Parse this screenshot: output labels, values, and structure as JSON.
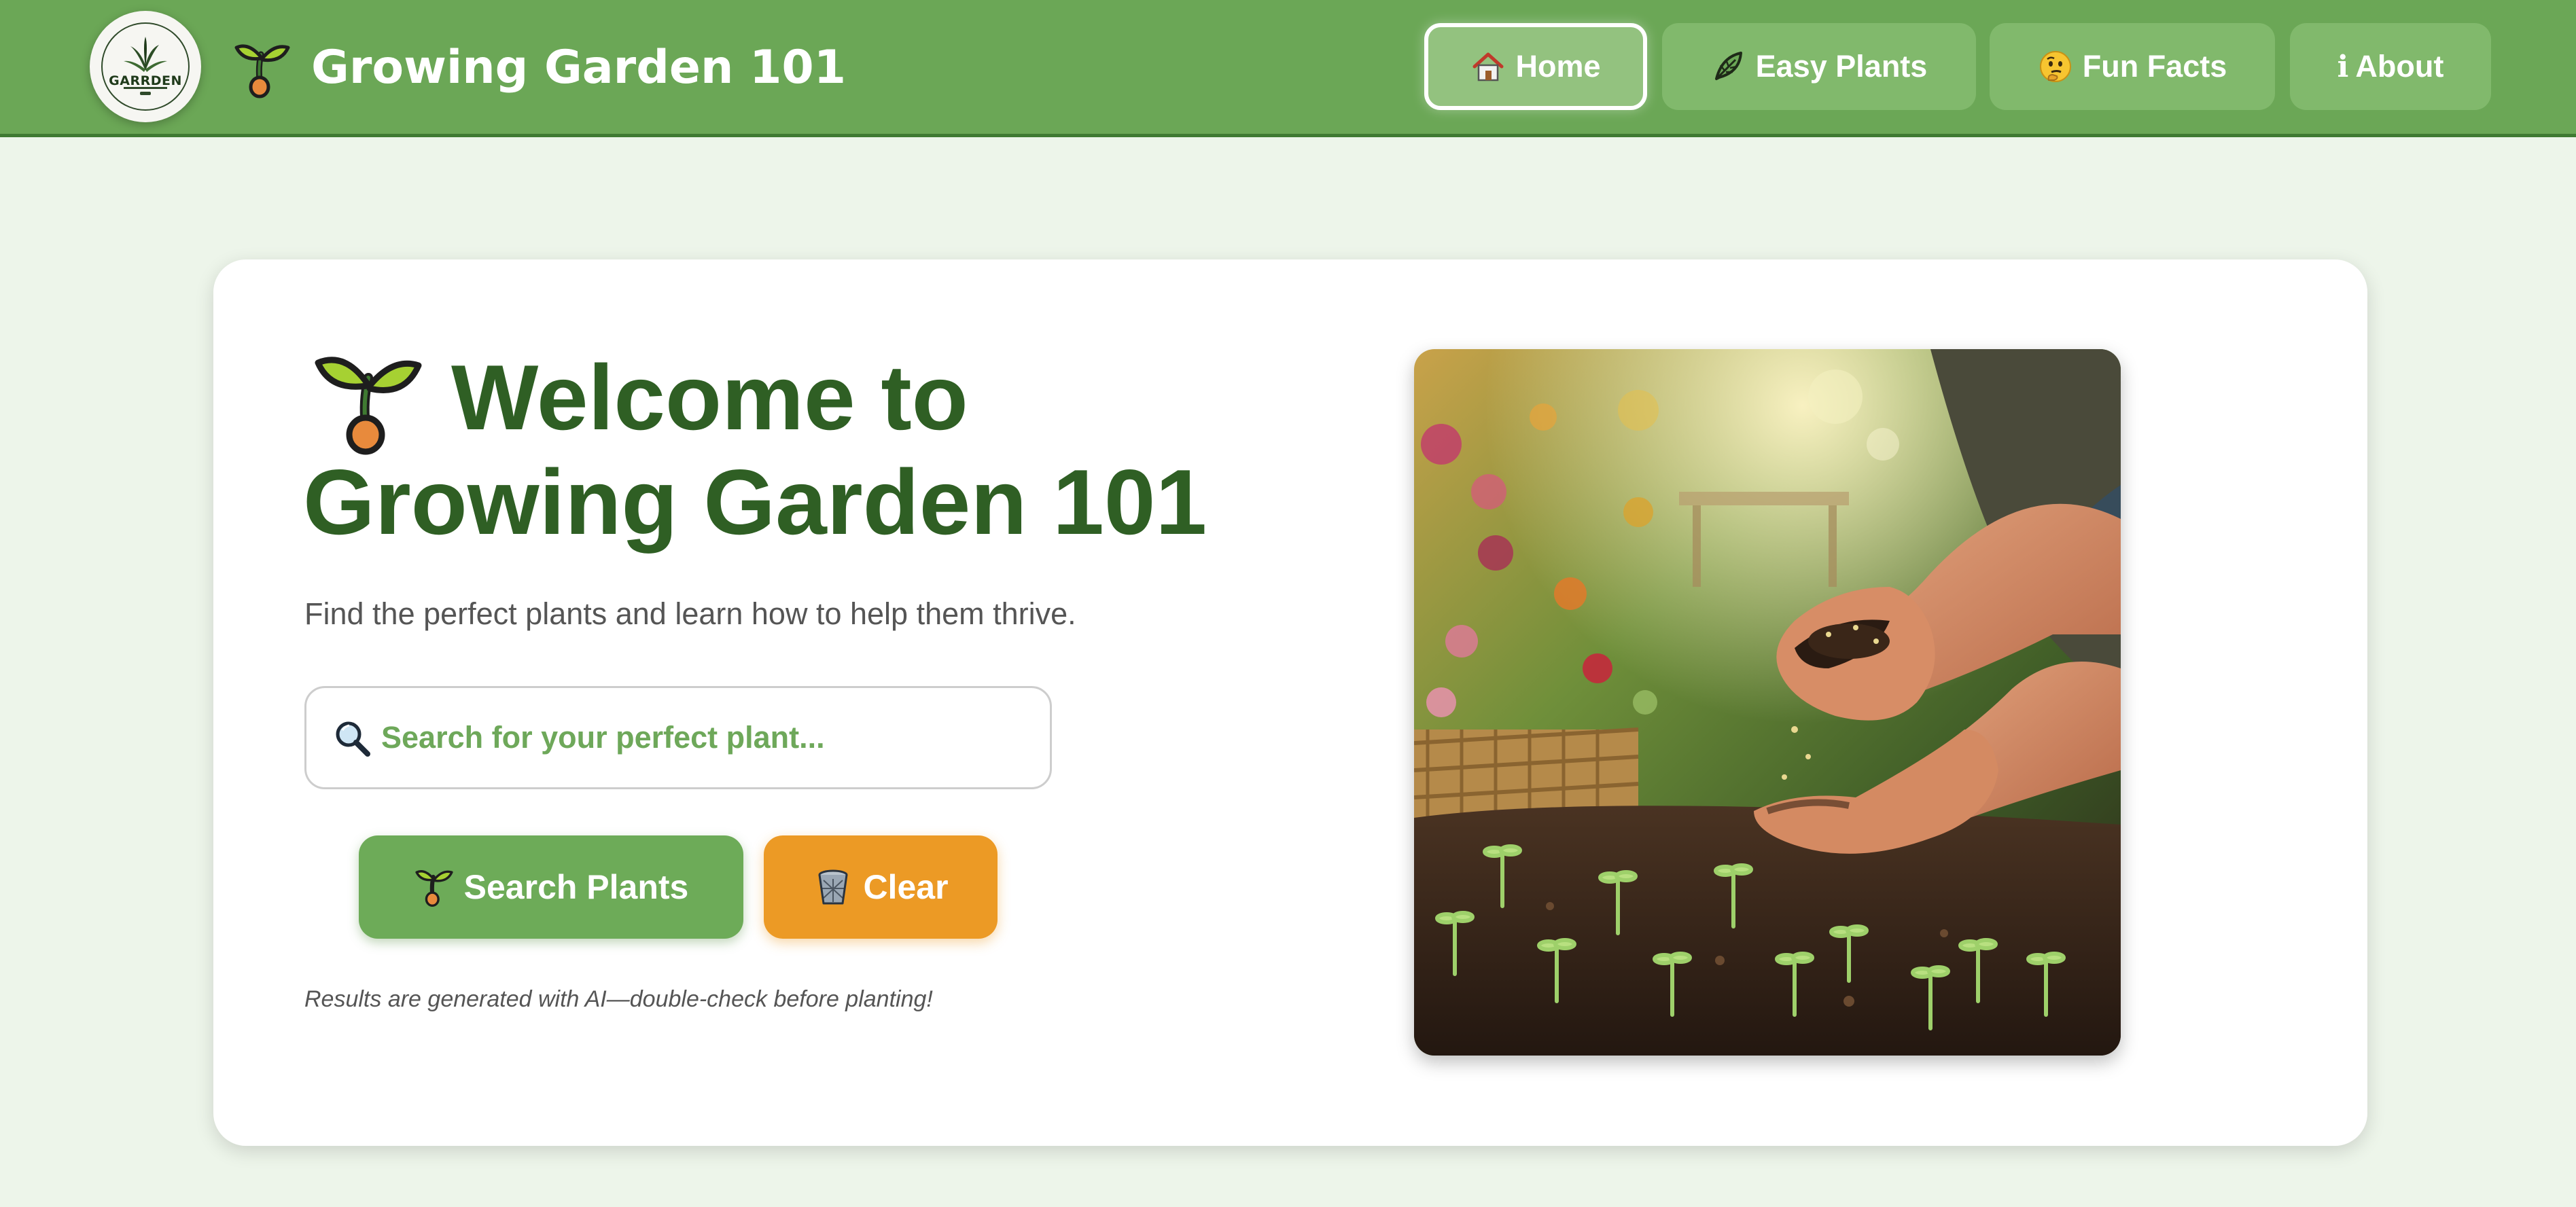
{
  "header": {
    "logo_text": "GARRDEN",
    "brand_title": "Growing Garden 101",
    "nav": [
      {
        "label": "Home",
        "icon": "house-icon",
        "active": true
      },
      {
        "label": "Easy Plants",
        "icon": "leaf-icon",
        "active": false
      },
      {
        "label": "Fun Facts",
        "icon": "thinking-face-icon",
        "active": false
      },
      {
        "label": "About",
        "icon": "info-icon",
        "active": false
      }
    ]
  },
  "hero": {
    "title_line1": "Welcome to",
    "title_line2": "Growing Garden 101",
    "subtitle": "Find the perfect plants and learn how to help them thrive.",
    "search_placeholder": "Search for your perfect plant...",
    "search_value": "",
    "search_button": "Search Plants",
    "clear_button": "Clear",
    "disclaimer": "Results are generated with AI—double-check before planting!",
    "image_alt": "gardener-hands-planting-seeds"
  },
  "colors": {
    "header_green": "#6ba756",
    "title_green": "#2f5f24",
    "button_green": "#6dab58",
    "button_orange": "#ec9a25",
    "page_background": "#edf5ea"
  }
}
